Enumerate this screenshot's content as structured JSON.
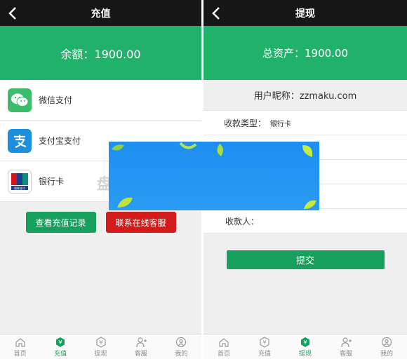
{
  "left": {
    "topbar": {
      "title": "充值"
    },
    "balance": "余额：1900.00",
    "pay_items": [
      {
        "label": "微信支付",
        "icon": "wechat-icon"
      },
      {
        "label": "支付宝支付",
        "icon": "alipay-icon"
      },
      {
        "label": "银行卡",
        "icon": "unionpay-icon"
      }
    ],
    "unionpay_caption": "银联支付",
    "buttons": {
      "records": "查看充值记录",
      "service": "联系在线客服"
    },
    "watermark": "盘"
  },
  "right": {
    "topbar": {
      "title": "提现"
    },
    "assets": "总资产：1900.00",
    "nickname": "用户昵称：zzmaku.com",
    "payee_type_label": "收款类型：",
    "payee_type_value": "银行卡",
    "payee_label": "收款人：",
    "submit": "提交"
  },
  "tabbar": [
    {
      "label": "首页",
      "icon": "home-icon"
    },
    {
      "label": "充值",
      "icon": "recharge-icon"
    },
    {
      "label": "提现",
      "icon": "withdraw-icon"
    },
    {
      "label": "客服",
      "icon": "service-icon"
    },
    {
      "label": "我的",
      "icon": "profile-icon"
    }
  ],
  "colors": {
    "green": "#20b26b",
    "button_green": "#17a05d",
    "red": "#d21c1c",
    "topbar": "#161616"
  }
}
